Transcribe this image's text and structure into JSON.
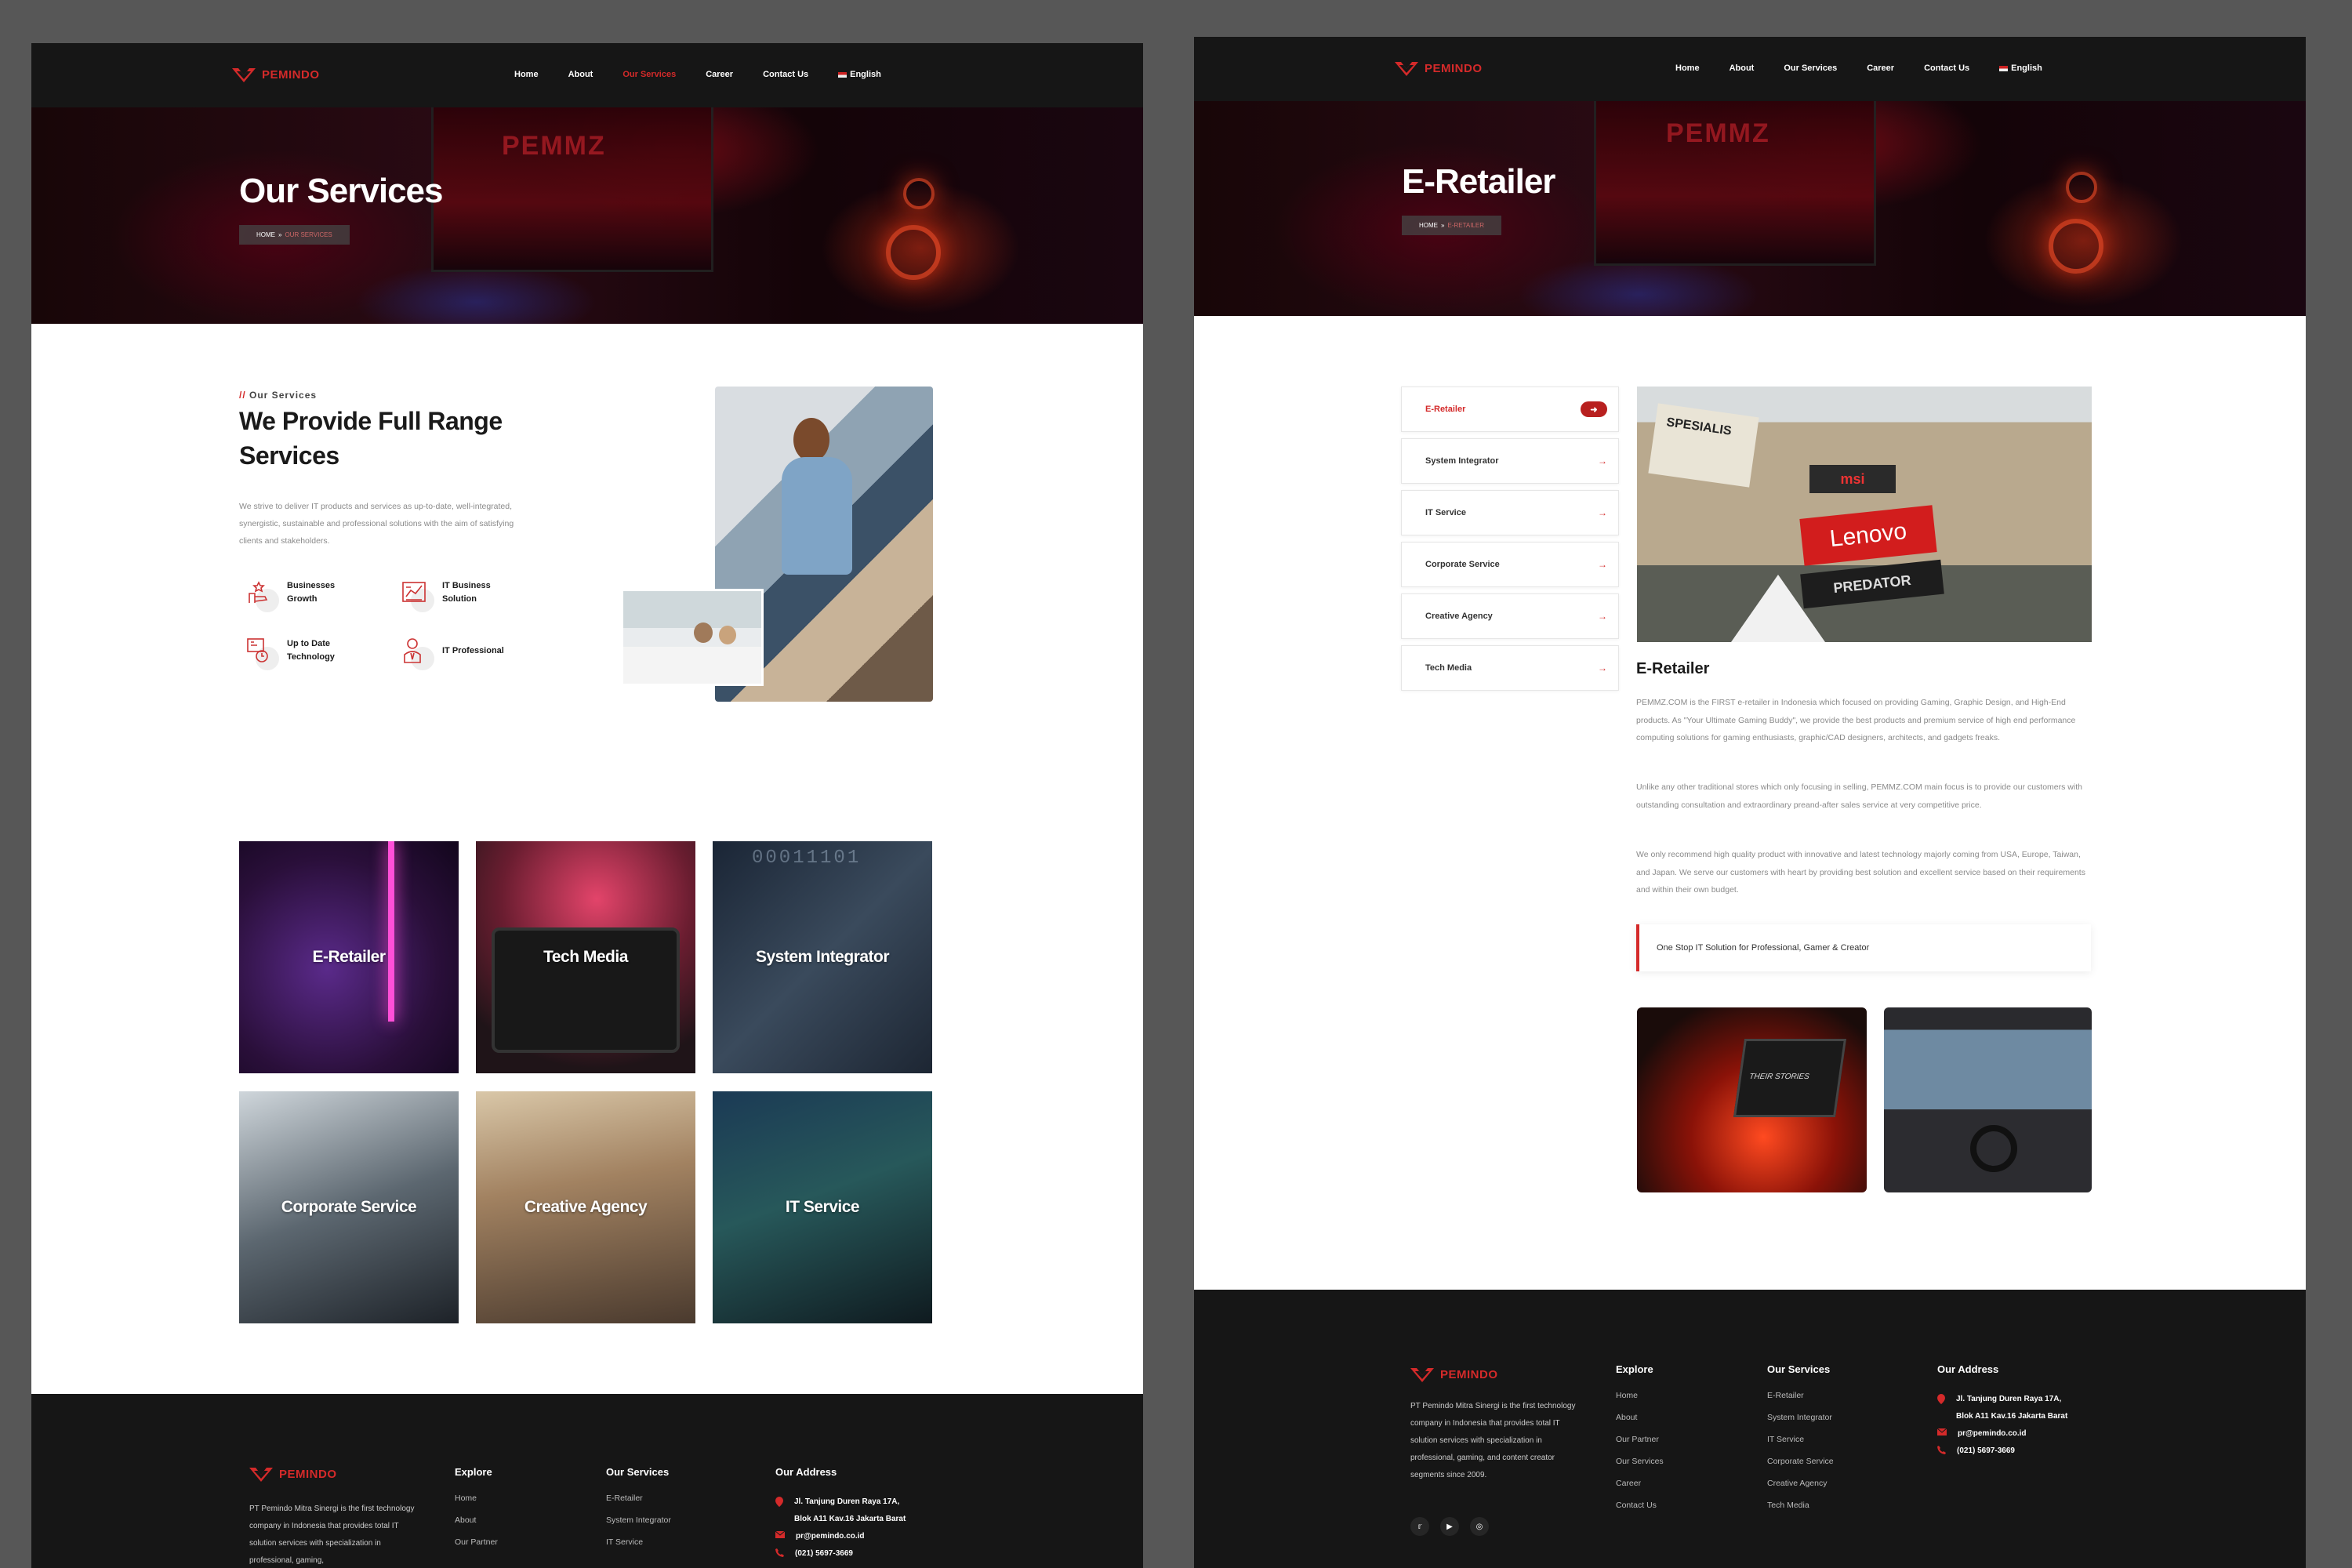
{
  "brand": "PEMINDO",
  "nav": {
    "items": [
      "Home",
      "About",
      "Our Services",
      "Career",
      "Contact Us"
    ],
    "lang": "English"
  },
  "colors": {
    "accent": "#d42a2a",
    "dark": "#161616"
  },
  "left": {
    "hero": {
      "title": "Our Services",
      "crumb_home": "HOME",
      "crumb_sep": "»",
      "crumb_current": "OUR SERVICES",
      "watermark": "PEMMZ"
    },
    "about": {
      "tag_slash": "//",
      "tag": "Our Services",
      "title": "We Provide Full Range Services",
      "desc": "We strive to deliver IT products and services as up-to-date, well-integrated, synergistic, sustainable and professional solutions with the aim of satisfying clients and stakeholders.",
      "features": [
        {
          "label": "Businesses Growth",
          "icon": "growth-icon"
        },
        {
          "label": "IT Business Solution",
          "icon": "chart-icon"
        },
        {
          "label": "Up to Date Technology",
          "icon": "technology-icon"
        },
        {
          "label": "IT Professional",
          "icon": "professional-icon"
        }
      ]
    },
    "tiles": [
      "E-Retailer",
      "Tech Media",
      "System Integrator",
      "Corporate Service",
      "Creative Agency",
      "IT Service"
    ],
    "footer": {
      "desc": "PT Pemindo Mitra Sinergi is the first technology company in Indonesia that provides total IT solution services with specialization in professional, gaming,",
      "explore_title": "Explore",
      "explore": [
        "Home",
        "About",
        "Our Partner"
      ],
      "services_title": "Our Services",
      "services": [
        "E-Retailer",
        "System Integrator",
        "IT Service"
      ],
      "address_title": "Our Address",
      "address1": "Jl. Tanjung Duren Raya 17A,",
      "address2": "Blok A11 Kav.16 Jakarta Barat",
      "email": "pr@pemindo.co.id",
      "phone": "(021) 5697-3669"
    }
  },
  "right": {
    "hero": {
      "title": "E-Retailer",
      "crumb_home": "HOME",
      "crumb_sep": "»",
      "crumb_current": "E-RETAILER",
      "watermark": "PEMMZ"
    },
    "sidebar": [
      "E-Retailer",
      "System Integrator",
      "IT Service",
      "Corporate Service",
      "Creative Agency",
      "Tech Media"
    ],
    "content": {
      "title": "E-Retailer",
      "p1": "PEMMZ.COM is the FIRST e-retailer in Indonesia which focused on providing Gaming, Graphic Design, and High-End products. As \"Your Ultimate Gaming Buddy\", we provide the best products and premium service of high end performance computing solutions for gaming enthusiasts, graphic/CAD designers, architects, and gadgets freaks.",
      "p2": "Unlike any other traditional stores which only focusing in selling, PEMMZ.COM main focus is to provide our customers with outstanding consultation and extraordinary preand-after sales service at very competitive price.",
      "p3": "We only recommend high quality product with innovative and latest technology majorly coming from USA, Europe, Taiwan, and Japan. We serve our customers with heart by providing best solution and excellent service based on their requirements and within their own budget.",
      "quote": "One Stop IT Solution for Professional, Gamer & Creator",
      "store_signs": [
        "SPESIALIS",
        "msi",
        "Lenovo",
        "PREDATOR"
      ],
      "laptop_text": "THEIR STORIES"
    },
    "footer": {
      "desc": "PT Pemindo Mitra Sinergi is the first technology company in Indonesia that provides total IT solution services with specialization in professional, gaming, and content creator segments since 2009.",
      "explore_title": "Explore",
      "explore": [
        "Home",
        "About",
        "Our Partner",
        "Our Services",
        "Career",
        "Contact Us"
      ],
      "services_title": "Our Services",
      "services": [
        "E-Retailer",
        "System Integrator",
        "IT Service",
        "Corporate Service",
        "Creative Agency",
        "Tech Media"
      ],
      "address_title": "Our Address",
      "address1": "Jl. Tanjung Duren Raya 17A,",
      "address2": "Blok A11 Kav.16 Jakarta Barat",
      "email": "pr@pemindo.co.id",
      "phone": "(021) 5697-3669",
      "social": [
        "twitter-icon",
        "youtube-icon",
        "instagram-icon"
      ]
    }
  }
}
